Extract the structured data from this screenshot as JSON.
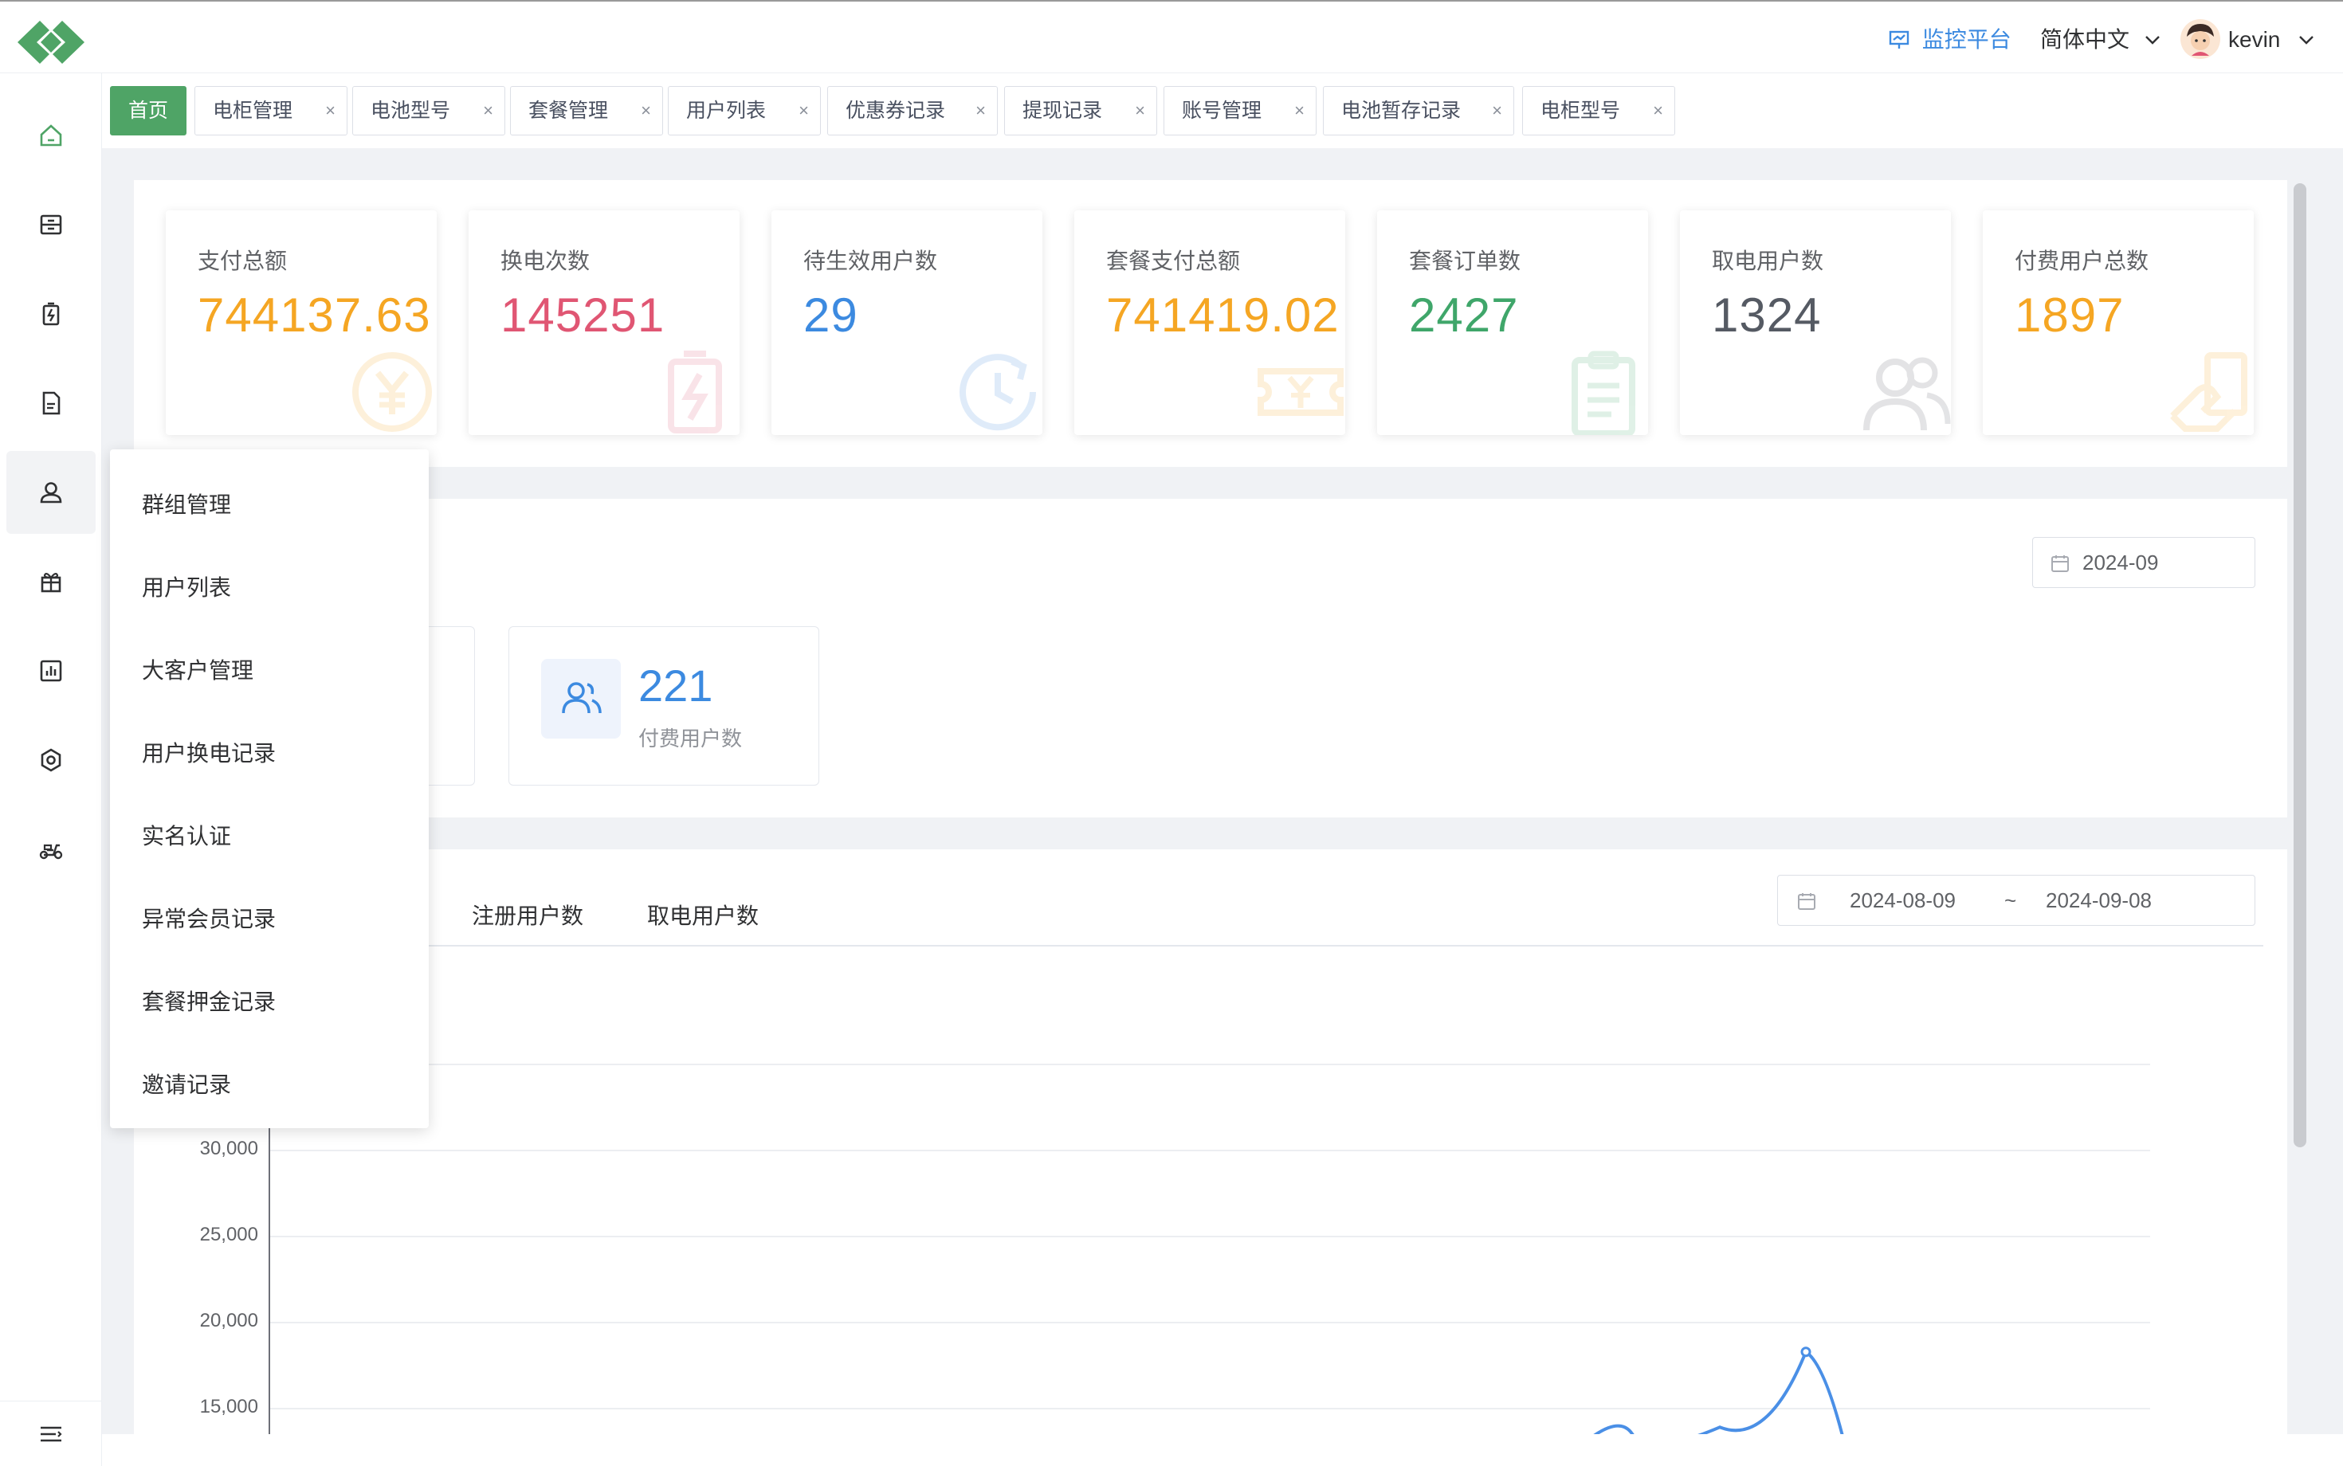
{
  "header": {
    "monitor_label": "监控平台",
    "language_label": "简体中文",
    "username": "kevin"
  },
  "sidebar": {
    "items": [
      {
        "icon": "home-icon"
      },
      {
        "icon": "cabinet-icon"
      },
      {
        "icon": "battery-icon"
      },
      {
        "icon": "document-icon"
      },
      {
        "icon": "user-icon"
      },
      {
        "icon": "gift-icon"
      },
      {
        "icon": "chart-icon"
      },
      {
        "icon": "settings-icon"
      },
      {
        "icon": "scooter-icon"
      }
    ],
    "collapse_icon": "menu-fold-icon"
  },
  "tabs": [
    {
      "label": "首页"
    },
    {
      "label": "电柜管理"
    },
    {
      "label": "电池型号"
    },
    {
      "label": "套餐管理"
    },
    {
      "label": "用户列表"
    },
    {
      "label": "优惠券记录"
    },
    {
      "label": "提现记录"
    },
    {
      "label": "账号管理"
    },
    {
      "label": "电池暂存记录"
    },
    {
      "label": "电柜型号"
    }
  ],
  "stats": [
    {
      "label": "支付总额",
      "value": "744137.63",
      "color": "#f5a623",
      "icon": "yuan-icon"
    },
    {
      "label": "换电次数",
      "value": "145251",
      "color": "#e05673",
      "icon": "battery-charge-icon"
    },
    {
      "label": "待生效用户数",
      "value": "29",
      "color": "#3c8ae0",
      "icon": "clock-icon"
    },
    {
      "label": "套餐支付总额",
      "value": "741419.02",
      "color": "#f5a623",
      "icon": "ticket-icon"
    },
    {
      "label": "套餐订单数",
      "value": "2427",
      "color": "#3fa66a",
      "icon": "clipboard-icon"
    },
    {
      "label": "取电用户数",
      "value": "1324",
      "color": "#555a63",
      "icon": "users-icon"
    },
    {
      "label": "付费用户总数",
      "value": "1897",
      "color": "#f5a623",
      "icon": "pay-icon"
    }
  ],
  "month_filter": {
    "value": "2024-09"
  },
  "paid_users": {
    "value": "221",
    "label": "付费用户数"
  },
  "chart_tabs": [
    "注册用户数",
    "取电用户数"
  ],
  "range_filter": {
    "start": "2024-08-09",
    "separator": "~",
    "end": "2024-09-08"
  },
  "chart_data": {
    "type": "line",
    "y_ticks": [
      "30,000",
      "25,000",
      "20,000",
      "15,000"
    ],
    "series": [
      {
        "values": [
          14000,
          14200,
          18300,
          13900
        ]
      }
    ]
  },
  "dropdown": {
    "items": [
      "群组管理",
      "用户列表",
      "大客户管理",
      "用户换电记录",
      "实名认证",
      "异常会员记录",
      "套餐押金记录",
      "邀请记录"
    ]
  },
  "colors": {
    "brand": "#4fa466",
    "link": "#3c8ae0",
    "line": "#4a8fe6"
  }
}
